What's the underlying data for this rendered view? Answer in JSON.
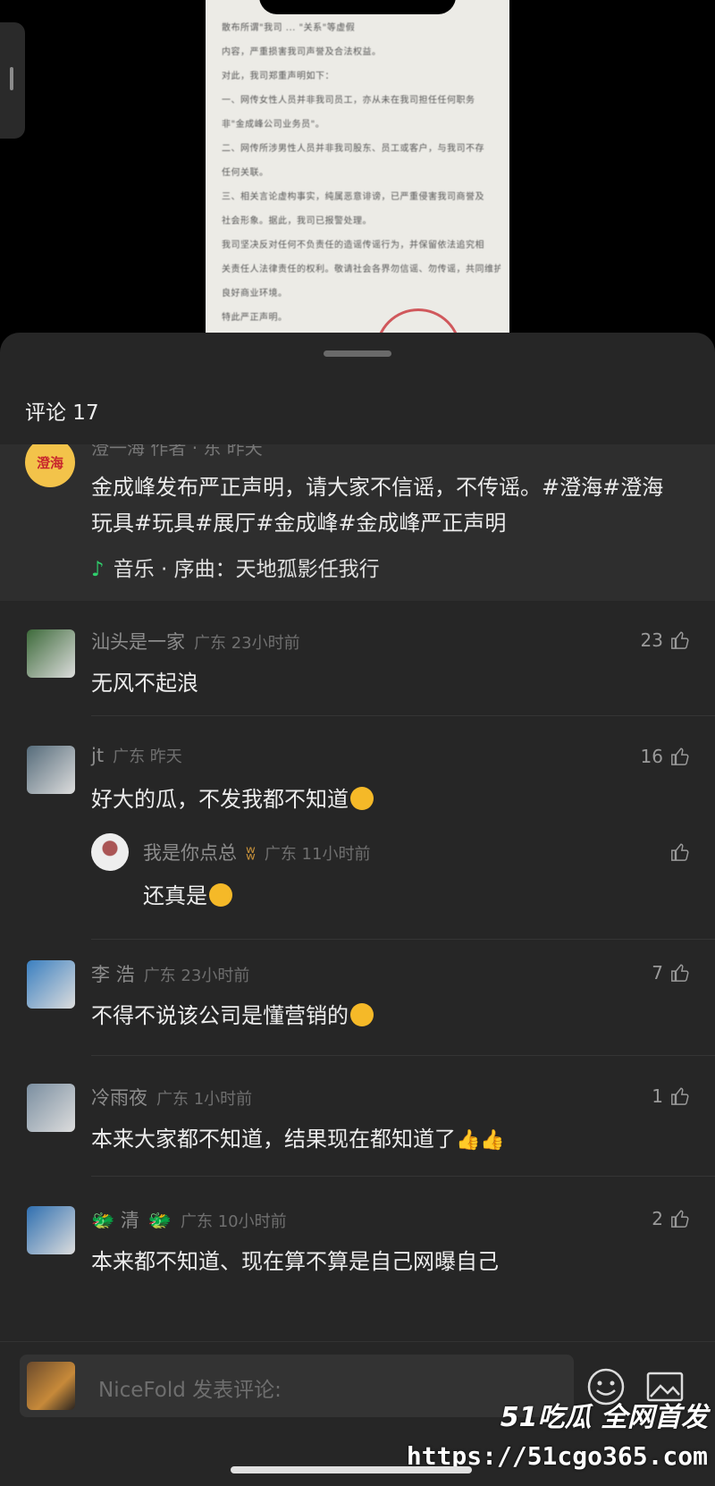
{
  "document": {
    "lines": [
      "散布所谓\"我司 ... \"关系\"等虚假",
      "内容，严重损害我司声誉及合法权益。",
      "对此，我司郑重声明如下：",
      "一、网传女性人员并非我司员工，亦从未在我司担任任何职务",
      "非\"金成峰公司业务员\"。",
      "二、网传所涉男性人员并非我司股东、员工或客户，与我司不存",
      "任何关联。",
      "三、相关言论虚构事实，纯属恶意诽谤，已严重侵害我司商誉及",
      "社会形象。据此，我司已报警处理。",
      "我司坚决反对任何不负责任的造谣传谣行为，并保留依法追究相",
      "关责任人法律责任的权利。敬请社会各界勿信谣、勿传谣，共同维护",
      "良好商业环境。",
      "特此严正声明。"
    ]
  },
  "sheet": {
    "title": "评论 17"
  },
  "pinned": {
    "avatar_text": "澄海",
    "header": "澄一海 作者 · 东 昨天",
    "text": "金成峰发布严正声明，请大家不信谣，不传谣。#澄海#澄海玩具#玩具#展厅#金成峰#金成峰严正声明",
    "music_label": "音乐 · 序曲：天地孤影任我行"
  },
  "comments": [
    {
      "name": "汕头是一家",
      "meta": "广东 23小时前",
      "text": "无风不起浪",
      "likes": "23",
      "color": "#3d6a3a"
    },
    {
      "name": "jt",
      "meta": "广东 昨天",
      "text": "好大的瓜，不发我都不知道",
      "likes": "16",
      "color": "#556b7a"
    },
    {
      "name": "李 浩",
      "meta": "广东 23小时前",
      "text": "不得不说该公司是懂营销的",
      "likes": "7",
      "color": "#3a7fc0"
    },
    {
      "name": "冷雨夜",
      "meta": "广东 1小时前",
      "text": "本来大家都不知道，结果现在都知道了",
      "likes": "1",
      "color": "#7a8ea0"
    },
    {
      "name": "清",
      "meta": "广东 10小时前",
      "text": "本来都不知道、现在算不算是自己网曝自己",
      "likes": "2",
      "color": "#2f6fb0"
    }
  ],
  "reply": {
    "name": "我是你点总",
    "meta": "广东 11小时前",
    "text": "还真是"
  },
  "input": {
    "placeholder": "NiceFold 发表评论:"
  },
  "watermark": {
    "line1": "51吃瓜 全网首发",
    "line2": "https://51cgo365.com"
  },
  "colors": {
    "accent_green": "#2fcf6c",
    "sheet_bg": "#262626"
  }
}
